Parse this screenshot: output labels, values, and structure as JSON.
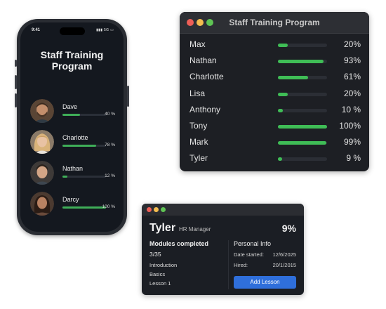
{
  "colors": {
    "accent_green": "#3fbd56",
    "window_bg": "#1d1f24",
    "button_blue": "#2f6fdb"
  },
  "phone": {
    "status_time": "9:41",
    "status_icons": "5G",
    "title": "Staff Training Program",
    "staff": [
      {
        "name": "Dave",
        "progress": 0.4,
        "pct_label": "40 %",
        "avatar": "man-short-hair-beard"
      },
      {
        "name": "Charlotte",
        "progress": 0.78,
        "pct_label": "78 %",
        "avatar": "woman-blonde-hair"
      },
      {
        "name": "Nathan",
        "progress": 0.12,
        "pct_label": "12 %",
        "avatar": "man-dark-hair"
      },
      {
        "name": "Darcy",
        "progress": 1.0,
        "pct_label": "100 %",
        "avatar": "woman-dark-hair"
      }
    ]
  },
  "overview_window": {
    "title": "Staff Training Program",
    "rows": [
      {
        "name": "Max",
        "progress": 0.2,
        "pct_label": "20%"
      },
      {
        "name": "Nathan",
        "progress": 0.93,
        "pct_label": "93%"
      },
      {
        "name": "Charlotte",
        "progress": 0.61,
        "pct_label": "61%"
      },
      {
        "name": "Lisa",
        "progress": 0.2,
        "pct_label": "20%"
      },
      {
        "name": "Anthony",
        "progress": 0.1,
        "pct_label": "10 %"
      },
      {
        "name": "Tony",
        "progress": 1.0,
        "pct_label": "100%"
      },
      {
        "name": "Mark",
        "progress": 0.99,
        "pct_label": "99%"
      },
      {
        "name": "Tyler",
        "progress": 0.09,
        "pct_label": "9 %"
      }
    ]
  },
  "detail_window": {
    "name": "Tyler",
    "role": "HR Manager",
    "percent": "9%",
    "modules_heading": "Modules completed",
    "modules_count": "3/35",
    "modules": [
      "Introduction",
      "Basics",
      "Lesson 1"
    ],
    "personal_heading": "Personal Info",
    "date_started_label": "Date started:",
    "date_started_value": "12/6/2025",
    "hired_label": "Hired:",
    "hired_value": "20/1/2015",
    "add_lesson_label": "Add Lesson"
  }
}
